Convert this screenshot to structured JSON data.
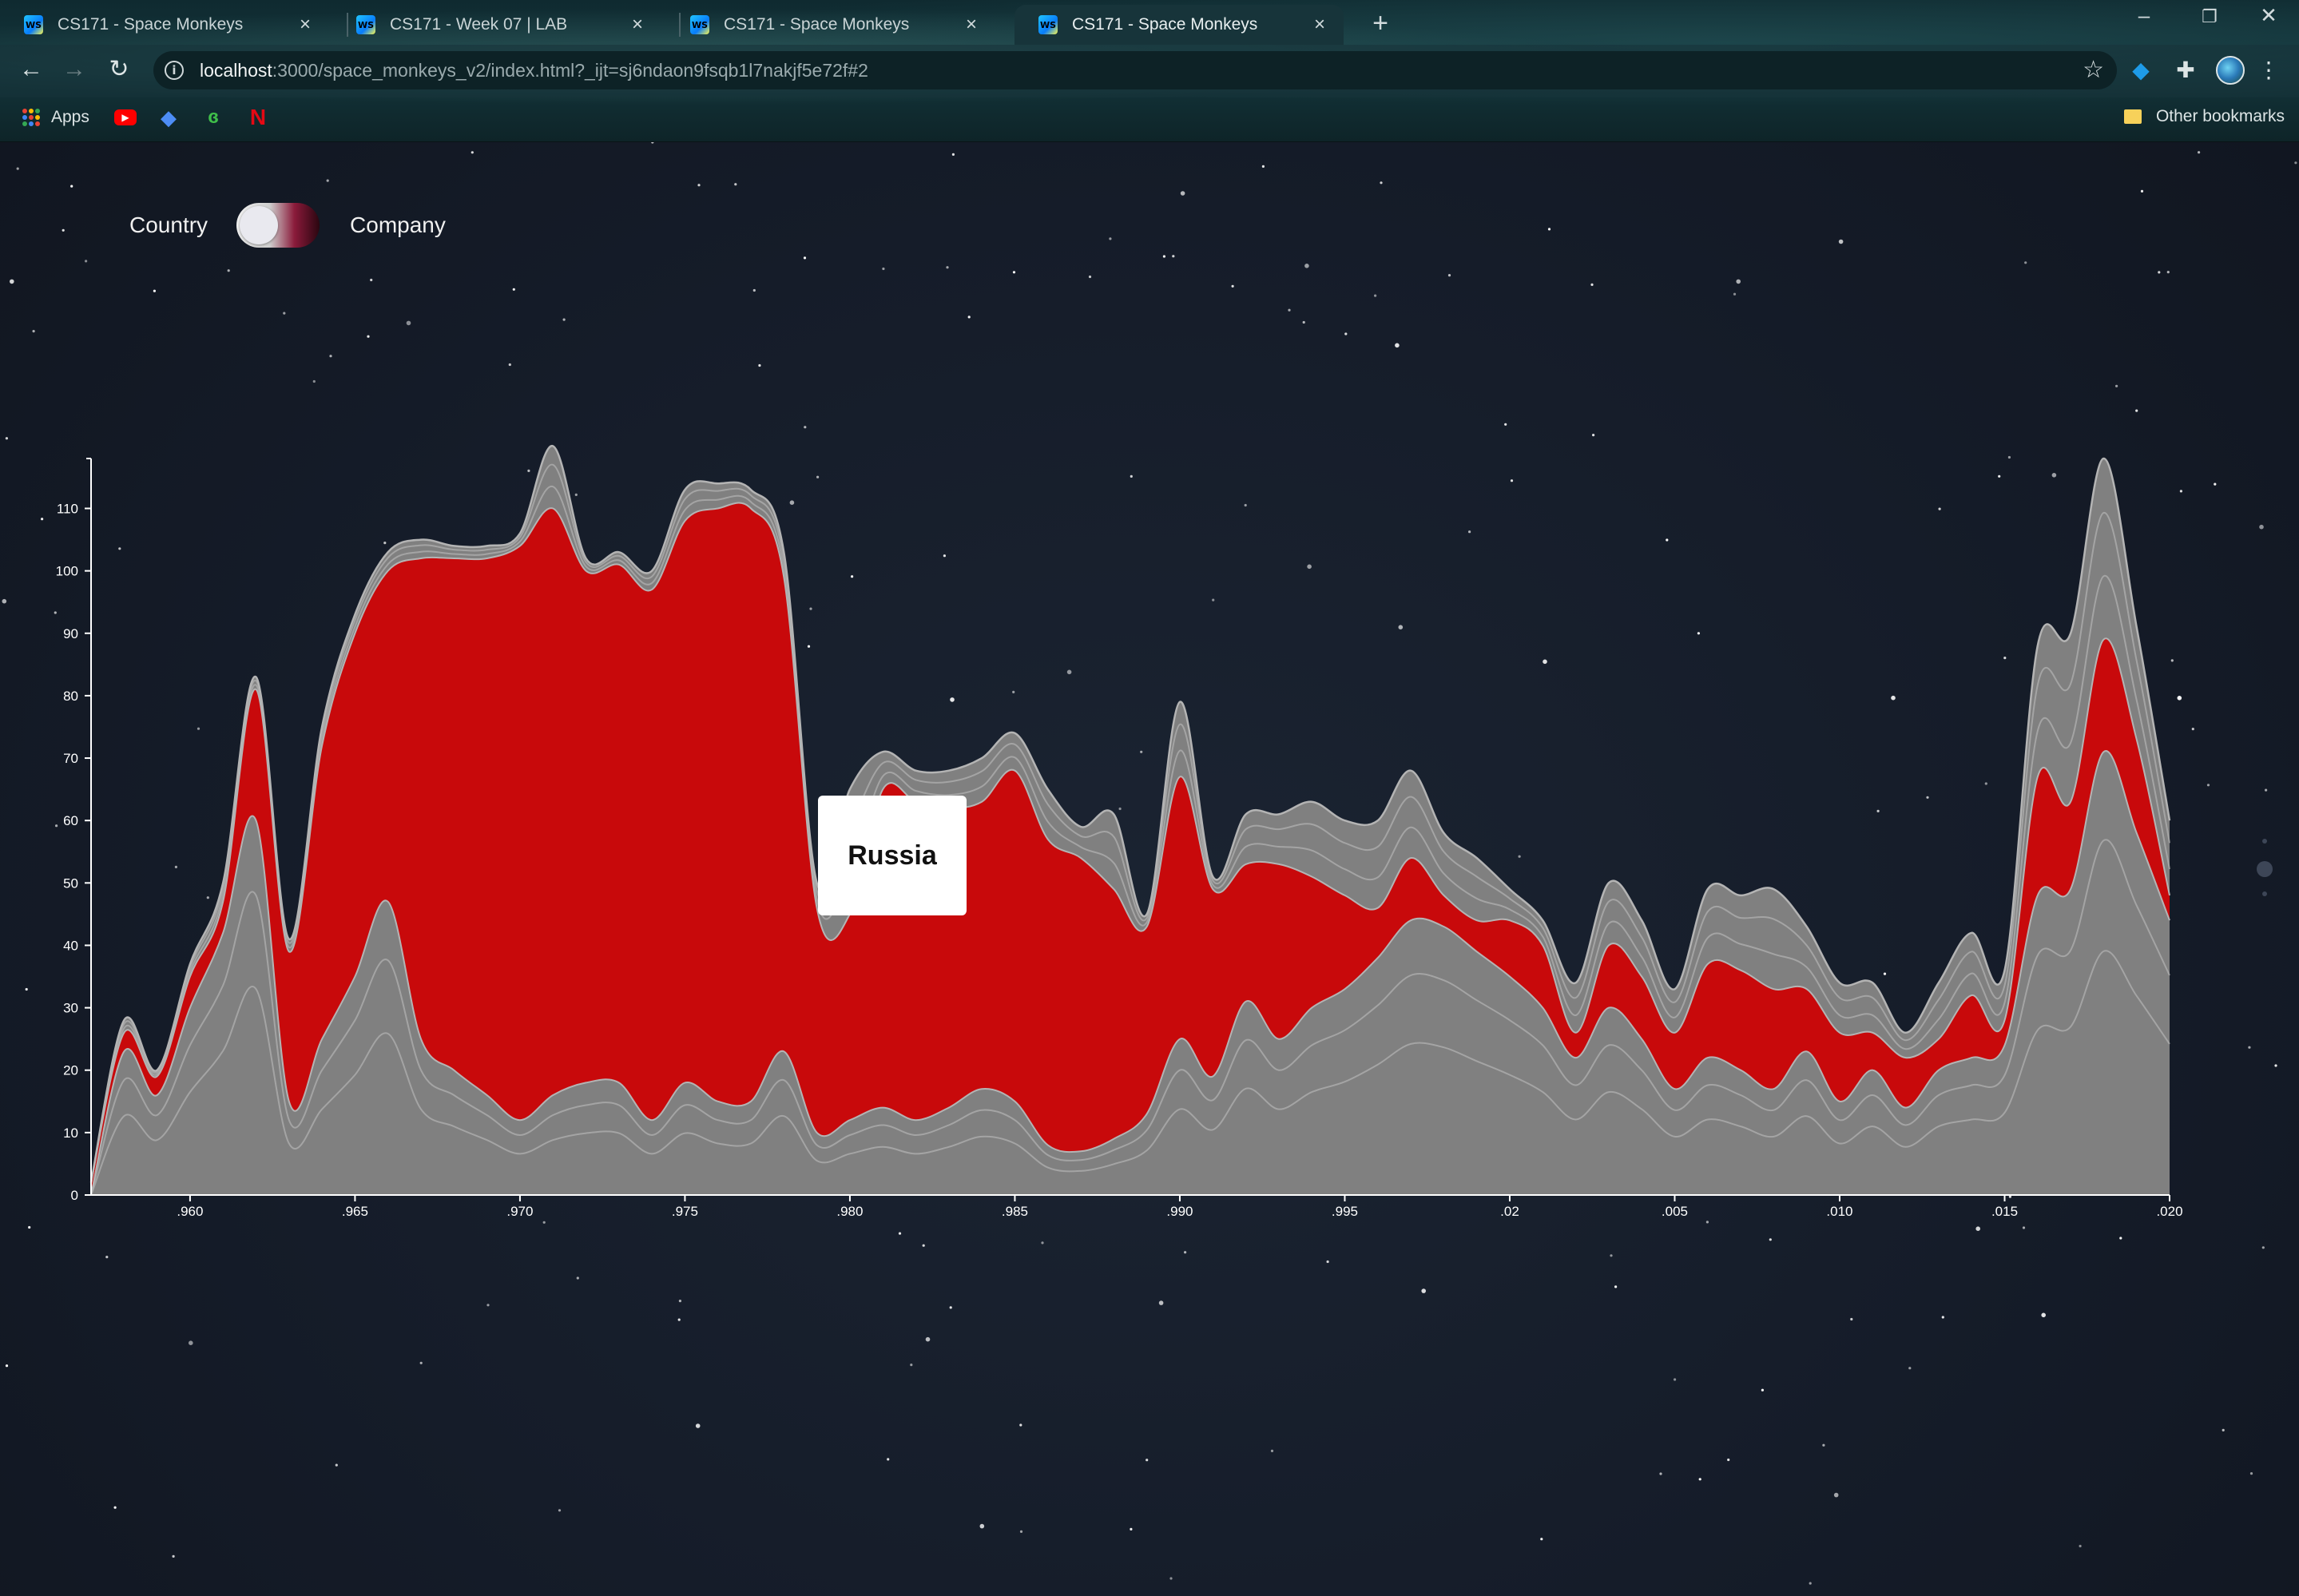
{
  "browser": {
    "tabs": [
      {
        "title": "CS171 - Space Monkeys",
        "active": false
      },
      {
        "title": "CS171 - Week 07 | LAB",
        "active": false
      },
      {
        "title": "CS171 - Space Monkeys",
        "active": false
      },
      {
        "title": "CS171 - Space Monkeys",
        "active": true
      }
    ],
    "favicon_text": "WS",
    "url_host": "localhost",
    "url_rest": ":3000/space_monkeys_v2/index.html?_ijt=sj6ndaon9fsqb1l7nakjf5e72f#2",
    "bookmarks": {
      "apps_label": "Apps",
      "other_label": "Other bookmarks"
    },
    "icons": [
      "back-arrow-icon",
      "forward-arrow-icon",
      "reload-icon",
      "info-icon",
      "star-icon",
      "diamond-extension-icon",
      "puzzle-extensions-icon",
      "avatar-icon",
      "kebab-menu-icon",
      "apps-grid-icon",
      "youtube-icon",
      "folder-icon"
    ]
  },
  "toggle": {
    "left_label": "Country",
    "right_label": "Company",
    "selected": "Country"
  },
  "tooltip": {
    "text": "Russia"
  },
  "colors": {
    "highlight": "#c8090b",
    "stream_gray": "#808080",
    "stream_stroke": "#b4b4b4"
  },
  "chart_data": {
    "type": "area",
    "stacked": true,
    "highlighted_series": "Russia",
    "x_tick_labels": [
      ".960",
      ".965",
      ".970",
      ".975",
      ".980",
      ".985",
      ".990",
      ".995",
      ".02",
      ".005",
      ".010",
      ".015",
      ".020"
    ],
    "x_tick_years": [
      1960,
      1965,
      1970,
      1975,
      1980,
      1985,
      1990,
      1995,
      2000,
      2005,
      2010,
      2015,
      2020
    ],
    "xlim": [
      1957,
      2020
    ],
    "ylim": [
      0,
      118
    ],
    "y_ticks": [
      0,
      10,
      20,
      30,
      40,
      50,
      60,
      70,
      80,
      90,
      100,
      110
    ],
    "years": [
      1957,
      1958,
      1959,
      1960,
      1961,
      1962,
      1963,
      1964,
      1965,
      1966,
      1967,
      1968,
      1969,
      1970,
      1971,
      1972,
      1973,
      1974,
      1975,
      1976,
      1977,
      1978,
      1979,
      1980,
      1981,
      1982,
      1983,
      1984,
      1985,
      1986,
      1987,
      1988,
      1989,
      1990,
      1991,
      1992,
      1993,
      1994,
      1995,
      1996,
      1997,
      1998,
      1999,
      2000,
      2001,
      2002,
      2003,
      2004,
      2005,
      2006,
      2007,
      2008,
      2009,
      2010,
      2011,
      2012,
      2013,
      2014,
      2015,
      2016,
      2017,
      2018,
      2019,
      2020
    ],
    "below_total": [
      0,
      23,
      16,
      30,
      42,
      60,
      15,
      25,
      35,
      47,
      25,
      20,
      16,
      12,
      16,
      18,
      18,
      12,
      18,
      15,
      15,
      23,
      10,
      12,
      14,
      12,
      14,
      17,
      15,
      8,
      7,
      9,
      13,
      25,
      19,
      31,
      25,
      30,
      33,
      38,
      44,
      43,
      39,
      35,
      30,
      22,
      30,
      25,
      17,
      22,
      20,
      17,
      23,
      15,
      20,
      14,
      20,
      22,
      24,
      48,
      49,
      71,
      58,
      44
    ],
    "russia": [
      2,
      3,
      3,
      5,
      5,
      21,
      24,
      47,
      55,
      53,
      77,
      82,
      86,
      92,
      94,
      82,
      83,
      85,
      90,
      95,
      95,
      76,
      36,
      33,
      51,
      51,
      48,
      46,
      53,
      49,
      47,
      40,
      30,
      42,
      30,
      22,
      28,
      21,
      15,
      8,
      10,
      5,
      5,
      9,
      10,
      4,
      10,
      10,
      9,
      15,
      16,
      16,
      10,
      11,
      6,
      8,
      5,
      10,
      4,
      19,
      14,
      18,
      15,
      4
    ],
    "above_total": [
      0,
      2,
      1,
      2,
      3,
      2,
      2,
      3,
      3,
      3,
      3,
      2,
      2,
      2,
      10,
      2,
      2,
      3,
      5,
      4,
      3,
      4,
      4,
      20,
      6,
      5,
      6,
      7,
      6,
      8,
      5,
      12,
      2,
      12,
      2,
      8,
      8,
      12,
      12,
      14,
      14,
      10,
      10,
      5,
      4,
      8,
      10,
      9,
      7,
      12,
      12,
      16,
      10,
      8,
      8,
      4,
      9,
      10,
      8,
      21,
      27,
      29,
      18,
      12
    ]
  }
}
